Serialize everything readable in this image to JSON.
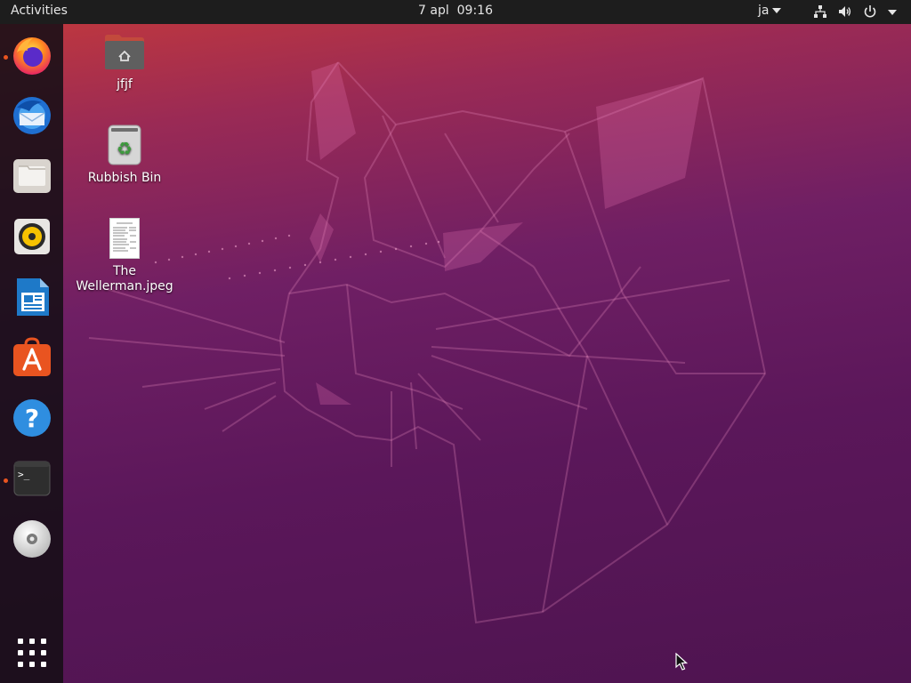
{
  "topbar": {
    "activities_label": "Activities",
    "datetime": "7 apl  09:16",
    "input_source": "ja",
    "icons": [
      "network-icon",
      "volume-icon",
      "power-icon",
      "system-menu-arrow-icon"
    ]
  },
  "dock": {
    "items": [
      {
        "name": "firefox",
        "icon": "firefox-icon",
        "running": true
      },
      {
        "name": "thunderbird",
        "icon": "thunderbird-icon",
        "running": false
      },
      {
        "name": "files",
        "icon": "files-icon",
        "running": false
      },
      {
        "name": "rhythmbox",
        "icon": "rhythmbox-icon",
        "running": false
      },
      {
        "name": "libreoffice-writer",
        "icon": "writer-icon",
        "running": false
      },
      {
        "name": "ubuntu-software",
        "icon": "software-icon",
        "running": false
      },
      {
        "name": "help",
        "icon": "help-icon",
        "running": false
      },
      {
        "name": "terminal",
        "icon": "terminal-icon",
        "running": true
      },
      {
        "name": "dvd-drive",
        "icon": "disc-icon",
        "running": false
      }
    ],
    "show_apps_icon": "app-grid-icon"
  },
  "desktop": {
    "icons": [
      {
        "label": "jfjf",
        "icon": "home-folder-icon"
      },
      {
        "label": "Rubbish Bin",
        "icon": "trash-icon"
      },
      {
        "label": "The Wellerman.jpeg",
        "label_lines": [
          "The",
          "Wellerman.jpeg"
        ],
        "icon": "image-file-icon"
      }
    ]
  },
  "colors": {
    "accent": "#e95420",
    "topbar_bg": "#1d1d1d",
    "dock_bg": "#160f16"
  }
}
